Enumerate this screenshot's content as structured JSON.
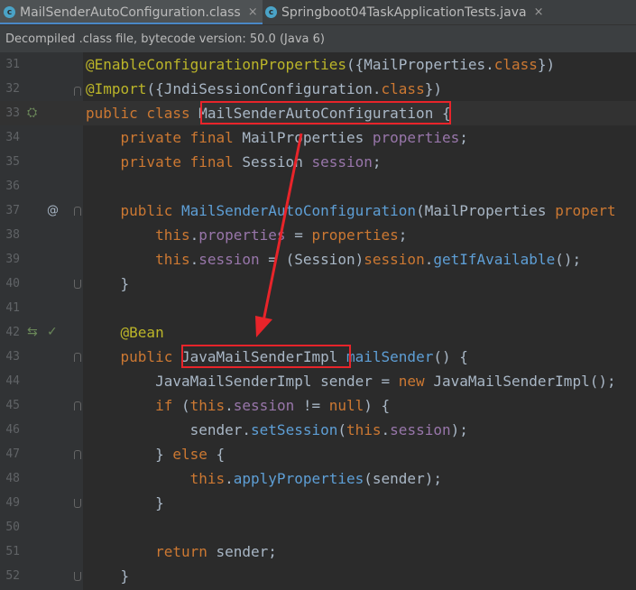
{
  "tabs": [
    {
      "label": "MailSenderAutoConfiguration.class",
      "icon": "class-file-icon",
      "active": true
    },
    {
      "label": "Springboot04TaskApplicationTests.java",
      "icon": "java-test-icon",
      "active": false
    }
  ],
  "banner": {
    "text": "Decompiled .class file, bytecode version: 50.0 (Java 6)"
  },
  "lines": [
    {
      "no": "31",
      "code": "@EnableConfigurationProperties({MailProperties.class})"
    },
    {
      "no": "32",
      "code": "@Import({JndiSessionConfiguration.class})"
    },
    {
      "no": "33",
      "code": "public class MailSenderAutoConfiguration {"
    },
    {
      "no": "34",
      "code": "    private final MailProperties properties;"
    },
    {
      "no": "35",
      "code": "    private final Session session;"
    },
    {
      "no": "36",
      "code": ""
    },
    {
      "no": "37",
      "code": "    public MailSenderAutoConfiguration(MailProperties properties"
    },
    {
      "no": "38",
      "code": "        this.properties = properties;"
    },
    {
      "no": "39",
      "code": "        this.session = (Session)session.getIfAvailable();"
    },
    {
      "no": "40",
      "code": "    }"
    },
    {
      "no": "41",
      "code": ""
    },
    {
      "no": "42",
      "code": "    @Bean"
    },
    {
      "no": "43",
      "code": "    public JavaMailSenderImpl mailSender() {"
    },
    {
      "no": "44",
      "code": "        JavaMailSenderImpl sender = new JavaMailSenderImpl();"
    },
    {
      "no": "45",
      "code": "        if (this.session != null) {"
    },
    {
      "no": "46",
      "code": "            sender.setSession(this.session);"
    },
    {
      "no": "47",
      "code": "        } else {"
    },
    {
      "no": "48",
      "code": "            this.applyProperties(sender);"
    },
    {
      "no": "49",
      "code": "        }"
    },
    {
      "no": "50",
      "code": ""
    },
    {
      "no": "51",
      "code": "        return sender;"
    },
    {
      "no": "52",
      "code": "    }"
    }
  ],
  "colors": {
    "highlight_box": "#e8242a",
    "keyword": "#cc7832",
    "annotation": "#bbb529",
    "field": "#9876aa",
    "method": "#ffc66d"
  }
}
